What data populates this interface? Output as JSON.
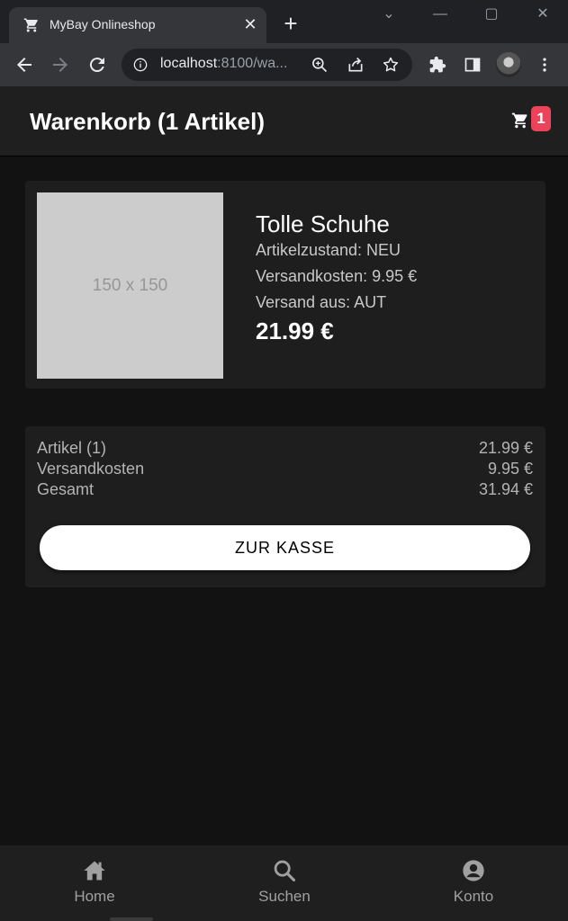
{
  "browser": {
    "tab_title": "MyBay Onlineshop",
    "url_host": "localhost",
    "url_path": ":8100/wa..."
  },
  "header": {
    "title": "Warenkorb (1 Artikel)",
    "cart_count": "1"
  },
  "product": {
    "image_placeholder": "150 x 150",
    "name": "Tolle Schuhe",
    "condition": "Artikelzustand: NEU",
    "shipping": "Versandkosten: 9.95 €",
    "ships_from": "Versand aus: AUT",
    "price": "21.99 €"
  },
  "summary": {
    "rows": [
      {
        "label": "Artikel (1)",
        "value": "21.99 €"
      },
      {
        "label": "Versandkosten",
        "value": "9.95 €"
      },
      {
        "label": "Gesamt",
        "value": "31.94 €"
      }
    ],
    "checkout_label": "ZUR KASSE"
  },
  "bottom_nav": {
    "items": [
      {
        "label": "Home",
        "icon": "home-icon"
      },
      {
        "label": "Suchen",
        "icon": "search-icon"
      },
      {
        "label": "Konto",
        "icon": "person-circle-icon"
      }
    ]
  },
  "colors": {
    "accent_badge": "#eb445a",
    "background": "#121212",
    "card": "#1e1e1e"
  }
}
